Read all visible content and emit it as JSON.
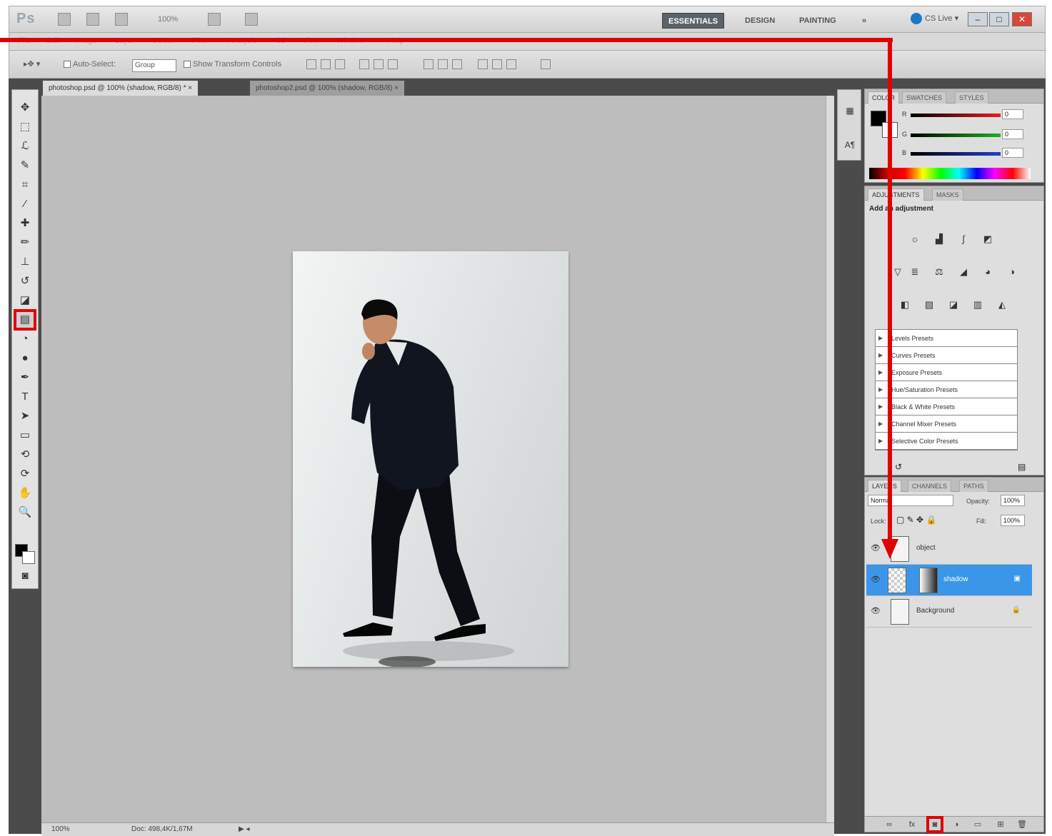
{
  "app": {
    "logo": "Ps",
    "zoom": "100%",
    "workspaces": [
      "ESSENTIALS",
      "DESIGN",
      "PAINTING",
      "»"
    ],
    "active_workspace": "ESSENTIALS",
    "cslive": "CS Live ▾",
    "accent_color": "#3b96ea",
    "annotation_color": "#e00000"
  },
  "menu": [
    "File",
    "Edit",
    "Image",
    "Layer",
    "Select",
    "Filter",
    "Analysis",
    "3D",
    "View",
    "Window",
    "Help"
  ],
  "options": {
    "tool": "▸✥ ▾",
    "auto_select_label": "Auto-Select:",
    "auto_select_value": "Group",
    "show_transform_label": "Show Transform Controls"
  },
  "tools": [
    {
      "name": "move-tool-icon",
      "glyph": "✥"
    },
    {
      "name": "marquee-tool-icon",
      "glyph": "⬚"
    },
    {
      "name": "lasso-tool-icon",
      "glyph": "ℒ"
    },
    {
      "name": "quick-select-tool-icon",
      "glyph": "✎"
    },
    {
      "name": "crop-tool-icon",
      "glyph": "⌗"
    },
    {
      "name": "eyedropper-tool-icon",
      "glyph": "⁄"
    },
    {
      "name": "healing-tool-icon",
      "glyph": "✚"
    },
    {
      "name": "brush-tool-icon",
      "glyph": "✏"
    },
    {
      "name": "stamp-tool-icon",
      "glyph": "⊥"
    },
    {
      "name": "history-brush-icon",
      "glyph": "↺"
    },
    {
      "name": "eraser-tool-icon",
      "glyph": "◪"
    },
    {
      "name": "gradient-tool-icon",
      "glyph": "▤"
    },
    {
      "name": "blur-tool-icon",
      "glyph": "◔"
    },
    {
      "name": "dodge-tool-icon",
      "glyph": "●"
    },
    {
      "name": "pen-tool-icon",
      "glyph": "✒"
    },
    {
      "name": "type-tool-icon",
      "glyph": "T"
    },
    {
      "name": "path-select-tool-icon",
      "glyph": "➤"
    },
    {
      "name": "shape-tool-icon",
      "glyph": "▭"
    },
    {
      "name": "3d-rotate-tool-icon",
      "glyph": "⟲"
    },
    {
      "name": "3d-orbit-tool-icon",
      "glyph": "⟳"
    },
    {
      "name": "hand-tool-icon",
      "glyph": "✋"
    },
    {
      "name": "zoom-tool-icon",
      "glyph": "🔍"
    }
  ],
  "documents": {
    "tabs": [
      {
        "label": "photoshop.psd @ 100% (shadow, RGB/8) * ×"
      },
      {
        "label": "photoshop2.psd @ 100% (shadow, RGB/8) ×"
      }
    ]
  },
  "status": {
    "zoom": "100%",
    "doc": "Doc: 498,4K/1,67M"
  },
  "color_panel": {
    "tabs": [
      "COLOR",
      "SWATCHES",
      "STYLES"
    ],
    "channels": [
      {
        "label": "R",
        "value": "0",
        "color": "#e02020"
      },
      {
        "label": "G",
        "value": "0",
        "color": "#20b020"
      },
      {
        "label": "B",
        "value": "0",
        "color": "#2040d0"
      }
    ]
  },
  "adjustments_panel": {
    "tabs": [
      "ADJUSTMENTS",
      "MASKS"
    ],
    "title": "Add an adjustment",
    "presets": [
      "Levels Presets",
      "Curves Presets",
      "Exposure Presets",
      "Hue/Saturation Presets",
      "Black & White Presets",
      "Channel Mixer Presets",
      "Selective Color Presets"
    ]
  },
  "layers_panel": {
    "tabs": [
      "LAYERS",
      "CHANNELS",
      "PATHS"
    ],
    "blend_mode": "Normal",
    "opacity_label": "Opacity:",
    "opacity": "100%",
    "lock_label": "Lock:",
    "fill_label": "Fill:",
    "fill": "100%",
    "layers": [
      {
        "name": "object",
        "selected": false
      },
      {
        "name": "shadow",
        "selected": true
      },
      {
        "name": "Background",
        "selected": false
      }
    ]
  }
}
